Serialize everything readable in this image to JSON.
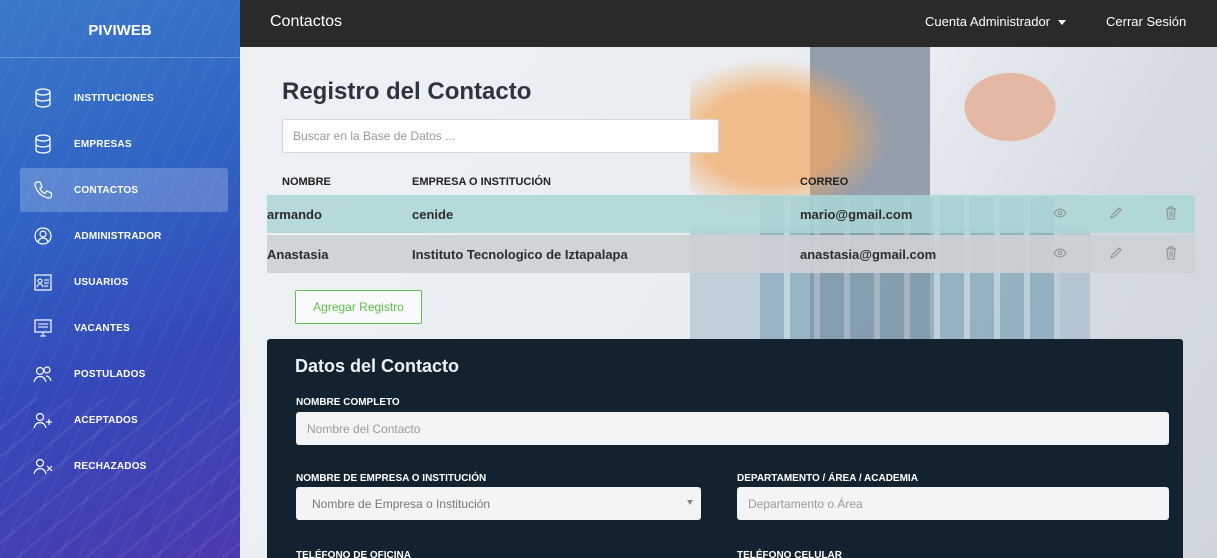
{
  "brand": "PIVIWEB",
  "sidebar": {
    "items": [
      {
        "label": "INSTITUCIONES",
        "icon": "database-icon"
      },
      {
        "label": "EMPRESAS",
        "icon": "database-icon"
      },
      {
        "label": "CONTACTOS",
        "icon": "phone-icon",
        "active": true
      },
      {
        "label": "ADMINISTRADOR",
        "icon": "admin-icon"
      },
      {
        "label": "USUARIOS",
        "icon": "users-id-icon"
      },
      {
        "label": "VACANTES",
        "icon": "monitor-icon"
      },
      {
        "label": "POSTULADOS",
        "icon": "group-icon"
      },
      {
        "label": "ACEPTADOS",
        "icon": "user-plus-icon"
      },
      {
        "label": "RECHAZADOS",
        "icon": "user-remove-icon"
      }
    ]
  },
  "topbar": {
    "title": "Contactos",
    "account": "Cuenta Administrador",
    "logout": "Cerrar Sesión"
  },
  "main": {
    "heading": "Registro del Contacto",
    "search_placeholder": "Buscar en la Base de Datos ...",
    "table": {
      "headers": [
        "NOMBRE",
        "EMPRESA O INSTITUCIÓN",
        "CORREO"
      ],
      "rows": [
        {
          "nombre": "armando",
          "empresa": "cenide",
          "correo": "mario@gmail.com"
        },
        {
          "nombre": "Anastasia",
          "empresa": "Instituto Tecnologico de Iztapalapa",
          "correo": "anastasia@gmail.com"
        }
      ]
    },
    "add_button": "Agregar Registro"
  },
  "form": {
    "title": "Datos del Contacto",
    "nombre_label": "NOMBRE COMPLETO",
    "nombre_placeholder": "Nombre del Contacto",
    "empresa_label": "NOMBRE DE EMPRESA O INSTITUCIÓN",
    "empresa_selected": "Nombre de Empresa o Institución",
    "depto_label": "DEPARTAMENTO / ÁREA / ACADEMIA",
    "depto_placeholder": "Departamento o Área",
    "tel_oficina_label": "TELÉFONO DE OFICINA",
    "tel_celular_label": "TELÉFONO CELULAR"
  },
  "colors": {
    "topbar": "#2a2a2a",
    "panel": "#12222e",
    "row_highlight": "#acd6d6",
    "accent_green": "#5fbf4a"
  }
}
